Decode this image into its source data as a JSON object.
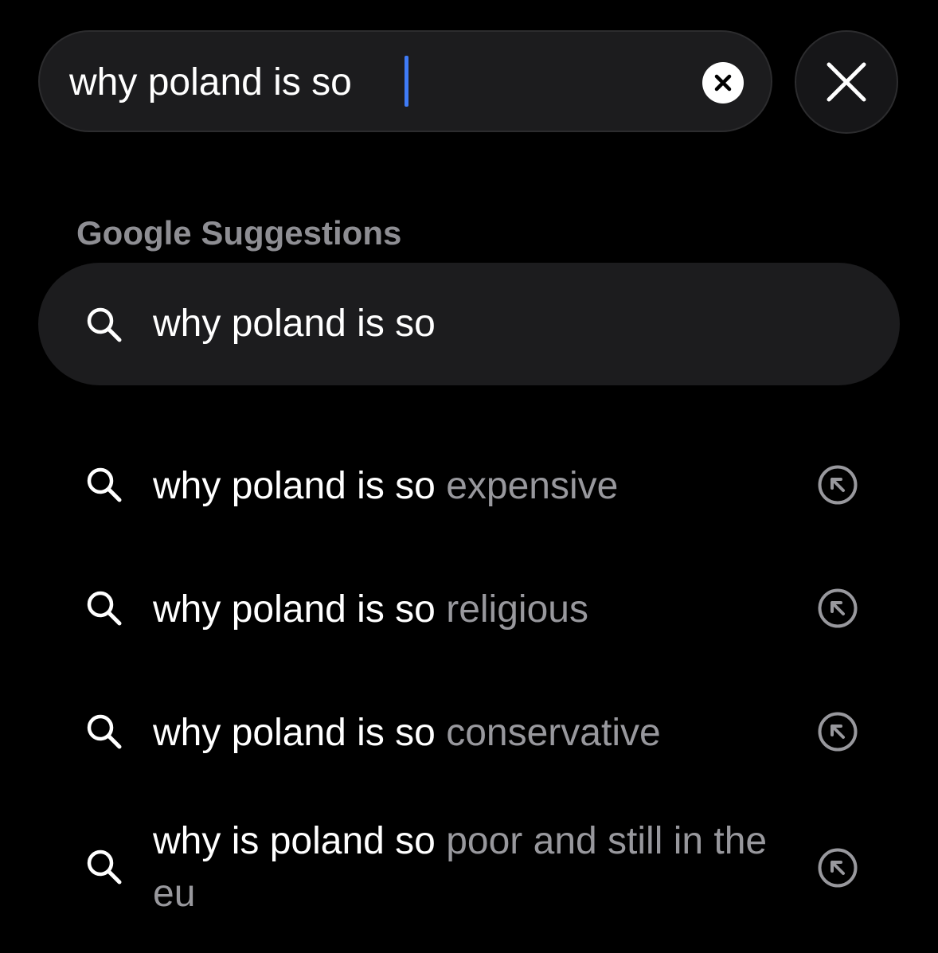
{
  "search_bar": {
    "value": "why poland is so",
    "clear_icon": "clear-circle-icon",
    "close_icon": "close-icon"
  },
  "section_title": "Google Suggestions",
  "top_suggestion": {
    "text": "why poland is so",
    "icon": "search-icon"
  },
  "suggestions": [
    {
      "query": "why poland is so",
      "completion": " expensive",
      "icon": "search-icon",
      "action_icon": "fill-arrow-icon"
    },
    {
      "query": "why poland is so",
      "completion": " religious",
      "icon": "search-icon",
      "action_icon": "fill-arrow-icon"
    },
    {
      "query": "why poland is so",
      "completion": " conservative",
      "icon": "search-icon",
      "action_icon": "fill-arrow-icon"
    },
    {
      "query": "why is poland so",
      "completion": " poor and still in the eu",
      "icon": "search-icon",
      "action_icon": "fill-arrow-icon"
    }
  ],
  "colors": {
    "background": "#000000",
    "field": "#1c1c1e",
    "caret": "#3f7bf6",
    "muted_text": "#98989d",
    "section_title": "#8e8e93"
  }
}
